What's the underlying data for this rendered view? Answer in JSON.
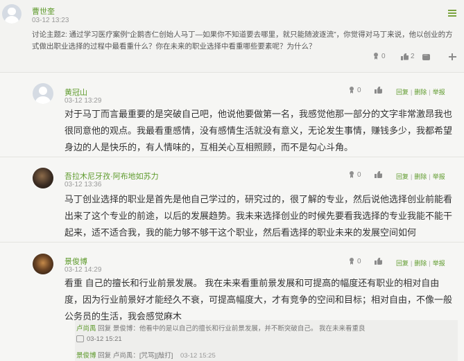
{
  "post": {
    "author": "曹世奎",
    "time": "03-12 13:23",
    "text": "讨论主题2: 通过学习医疗案例“企鹅杏仁创始人马丁—如果你不知道要去哪里，就只能随波逐流”，你觉得对马丁来说，他以创业的方式做出职业选择的过程中最看重什么？你在未来的职业选择中看重哪些要素呢？为什么？",
    "award_count": "0",
    "like_count": "2"
  },
  "comments": [
    {
      "author": "黄冠山",
      "time": "03-12 13:29",
      "award_count": "0",
      "text": "对于马丁而言最重要的是突破自己吧，他说他要做第一名，我感觉他那一部分的文字非常激昂我也很同意他的观点。我最看重感情，没有感情生活就没有意义，无论发生事情，赚钱多少，我都希望身边的人是快乐的，有人情味的，互相关心互相照顾，而不是勾心斗角。"
    },
    {
      "author": "吾拉木尼牙孜·阿布地如苏力",
      "time": "03-12 13:36",
      "award_count": "0",
      "text": "马丁创业选择的职业是首先是他自己学过的，研究过的，很了解的专业，然后说他选择创业前能看出来了这个专业的前途，以后的发展趋势。我未来选择创业的时候先要看我选择的专业我能不能干起来，适不适合我，我的能力够不够干这个职业，然后看选择的职业未来的发展空间如何"
    },
    {
      "author": "景俊博",
      "time": "03-12 14:29",
      "award_count": "0",
      "text": "看重 自己的擅长和行业前景发展。 我在未来看重前景发展和可提高的幅度还有职业的相对自由度，因为行业前景好才能经久不衰，可提高幅度大，才有竞争的空间和目标；相对自由，不像一般公务员的生活，我会感觉麻木"
    }
  ],
  "actions": {
    "reply": "回复",
    "delete": "删除",
    "report": "举报"
  },
  "replies": [
    {
      "author": "卢尚禹",
      "verb": "回复",
      "target": "景俊博",
      "text": "：他看中的是以自己的擅长和行业前景发展，并不断突破自己。 我在未来看重良",
      "time": "03-12 15:21"
    },
    {
      "author": "景俊博",
      "verb": "回复",
      "target": "卢尚禹",
      "text": "：[咒骂][敲打]",
      "time": "03-12 15:25"
    }
  ],
  "colors": {
    "accent": "#5f9b2d",
    "text": "#333333",
    "muted": "#999999"
  }
}
